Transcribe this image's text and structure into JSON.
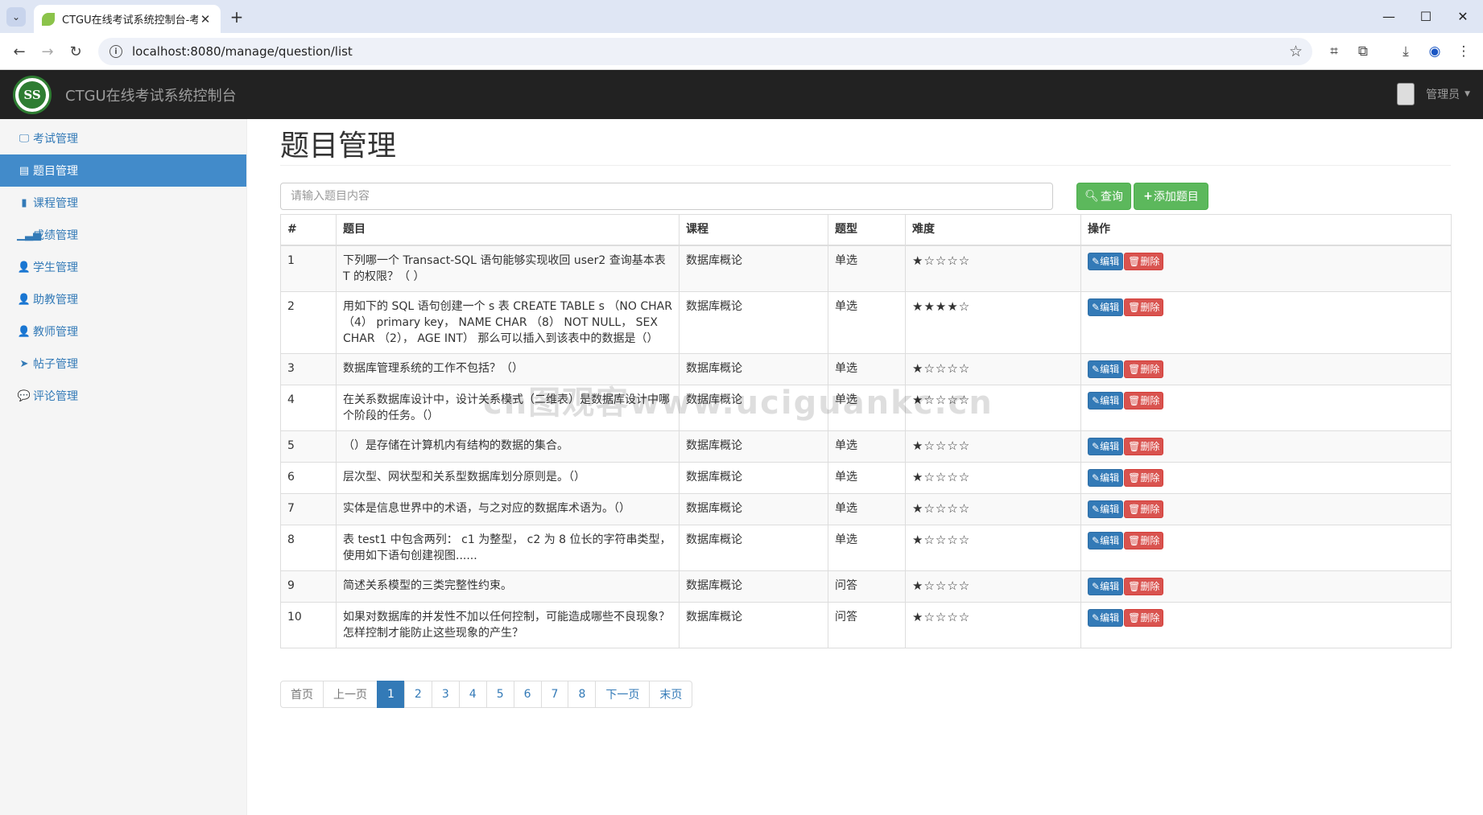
{
  "browser": {
    "tab_title": "CTGU在线考试系统控制台-考试",
    "url": "localhost:8080/manage/question/list"
  },
  "header": {
    "logo_text": "SS",
    "brand": "CTGU在线考试系统控制台",
    "user_label": "管理员"
  },
  "sidebar": {
    "items": [
      {
        "label": "考试管理",
        "icon": "monitor-icon"
      },
      {
        "label": "题目管理",
        "icon": "list-icon"
      },
      {
        "label": "课程管理",
        "icon": "book-icon"
      },
      {
        "label": "成绩管理",
        "icon": "bar-chart-icon"
      },
      {
        "label": "学生管理",
        "icon": "user-icon"
      },
      {
        "label": "助教管理",
        "icon": "user-icon"
      },
      {
        "label": "教师管理",
        "icon": "user-icon"
      },
      {
        "label": "帖子管理",
        "icon": "send-icon"
      },
      {
        "label": "评论管理",
        "icon": "comment-icon"
      }
    ],
    "active_index": 1
  },
  "main": {
    "title": "题目管理",
    "search_placeholder": "请输入题目内容",
    "query_label": "查询",
    "add_label": "添加题目",
    "columns": [
      "#",
      "题目",
      "课程",
      "题型",
      "难度",
      "操作"
    ],
    "edit_label": "编辑",
    "delete_label": "删除",
    "rows": [
      {
        "id": "1",
        "question": "下列哪一个 Transact-SQL 语句能够实现收回 user2 查询基本表 T 的权限？（ ）",
        "course": "数据库概论",
        "type": "单选",
        "difficulty": 1,
        "difficulty_stars": "★☆☆☆☆"
      },
      {
        "id": "2",
        "question": "用如下的 SQL 语句创建一个 s 表 CREATE TABLE s （NO CHAR （4） primary key， NAME CHAR （8） NOT NULL， SEX CHAR （2）， AGE INT） 那么可以插入到该表中的数据是（）",
        "course": "数据库概论",
        "type": "单选",
        "difficulty": 4,
        "difficulty_stars": "★★★★☆"
      },
      {
        "id": "3",
        "question": "数据库管理系统的工作不包括？（）",
        "course": "数据库概论",
        "type": "单选",
        "difficulty": 1,
        "difficulty_stars": "★☆☆☆☆"
      },
      {
        "id": "4",
        "question": "在关系数据库设计中，设计关系模式（二维表）是数据库设计中哪个阶段的任务。（）",
        "course": "数据库概论",
        "type": "单选",
        "difficulty": 1,
        "difficulty_stars": "★☆☆☆☆"
      },
      {
        "id": "5",
        "question": "（）是存储在计算机内有结构的数据的集合。",
        "course": "数据库概论",
        "type": "单选",
        "difficulty": 1,
        "difficulty_stars": "★☆☆☆☆"
      },
      {
        "id": "6",
        "question": "层次型、网状型和关系型数据库划分原则是。（）",
        "course": "数据库概论",
        "type": "单选",
        "difficulty": 1,
        "difficulty_stars": "★☆☆☆☆"
      },
      {
        "id": "7",
        "question": "实体是信息世界中的术语，与之对应的数据库术语为。（）",
        "course": "数据库概论",
        "type": "单选",
        "difficulty": 1,
        "difficulty_stars": "★☆☆☆☆"
      },
      {
        "id": "8",
        "question": "表 test1 中包含两列： c1 为整型， c2 为 8 位长的字符串类型，使用如下语句创建视图......",
        "course": "数据库概论",
        "type": "单选",
        "difficulty": 1,
        "difficulty_stars": "★☆☆☆☆"
      },
      {
        "id": "9",
        "question": "简述关系模型的三类完整性约束。",
        "course": "数据库概论",
        "type": "问答",
        "difficulty": 1,
        "difficulty_stars": "★☆☆☆☆"
      },
      {
        "id": "10",
        "question": "如果对数据库的并发性不加以任何控制，可能造成哪些不良现象？怎样控制才能防止这些现象的产生？",
        "course": "数据库概论",
        "type": "问答",
        "difficulty": 1,
        "difficulty_stars": "★☆☆☆☆"
      }
    ],
    "pagination": {
      "first": "首页",
      "prev": "上一页",
      "pages": [
        "1",
        "2",
        "3",
        "4",
        "5",
        "6",
        "7",
        "8"
      ],
      "current": "1",
      "next": "下一页",
      "last": "末页"
    }
  },
  "watermark": "cn图观客www.uciguankc.cn"
}
